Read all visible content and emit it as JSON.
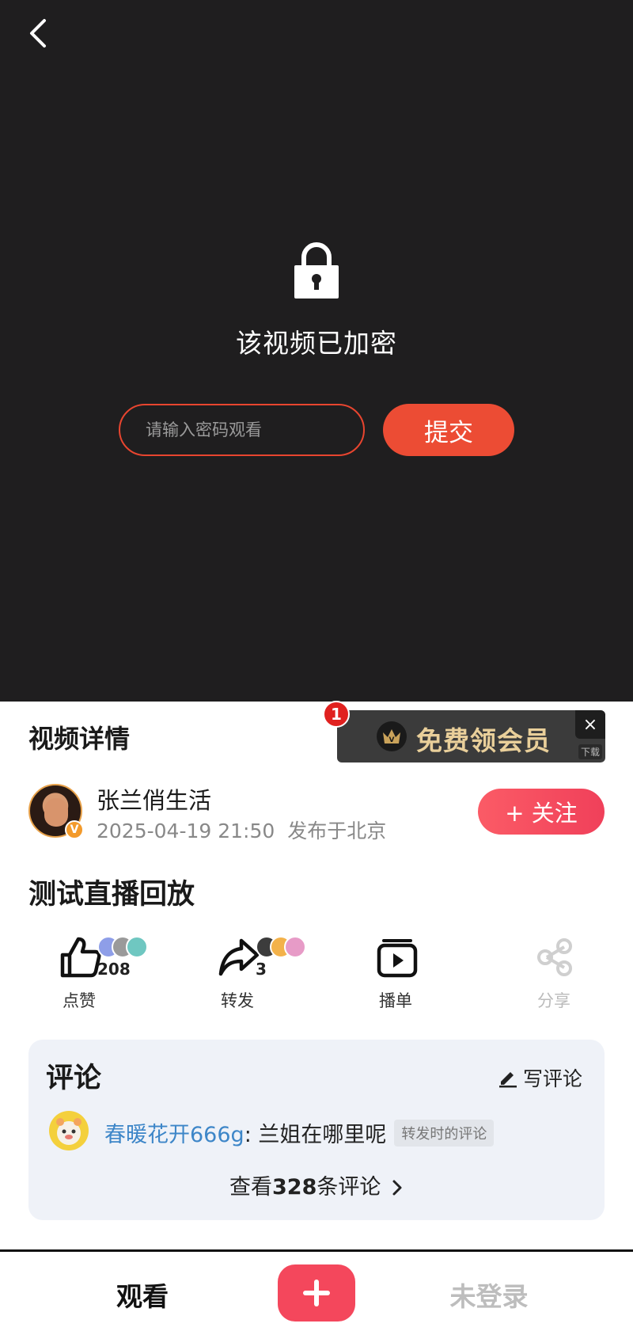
{
  "player": {
    "locked_message": "该视频已加密",
    "password_placeholder": "请输入密码观看",
    "submit_label": "提交"
  },
  "detail": {
    "section_title": "视频详情",
    "promo": {
      "badge_count": "1",
      "text": "免费领会员",
      "close": "×",
      "download_tag": "下载"
    },
    "author": {
      "name": "张兰俏生活",
      "verified_mark": "V",
      "timestamp": "2025-04-19 21:50",
      "location": "发布于北京",
      "follow_label": "+ 关注"
    },
    "video_title": "测试直播回放",
    "actions": {
      "like": {
        "label": "点赞",
        "count": "208"
      },
      "repost": {
        "label": "转发",
        "count": "3"
      },
      "playlist": {
        "label": "播单"
      },
      "share": {
        "label": "分享"
      }
    }
  },
  "comments": {
    "title": "评论",
    "write_label": "写评论",
    "items": [
      {
        "user": "春暖花开666g",
        "separator": ": ",
        "text": "兰姐在哪里呢",
        "tag": "转发时的评论"
      }
    ],
    "view_all_prefix": "查看",
    "view_all_count": "328",
    "view_all_suffix": "条评论"
  },
  "bottom_nav": {
    "watch_label": "观看",
    "login_label": "未登录"
  },
  "colors": {
    "accent_red": "#ec4c34",
    "follow_pink": "#f0405a",
    "link_blue": "#3d86c8",
    "promo_gold": "#e9cf9a"
  }
}
